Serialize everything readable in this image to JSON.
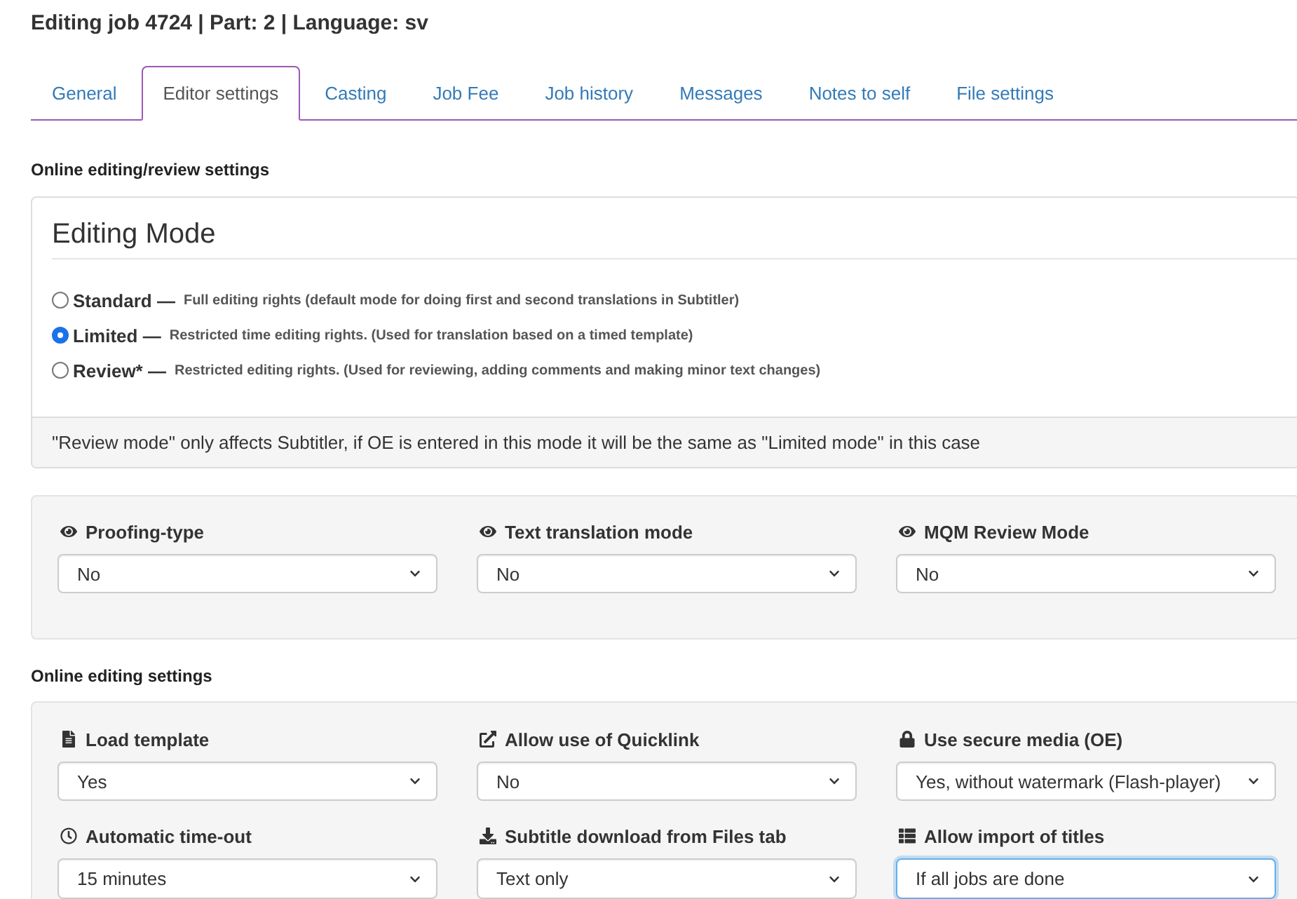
{
  "page": {
    "title": "Editing job 4724 | Part: 2 | Language: sv"
  },
  "tabs": [
    {
      "label": "General",
      "selected": false
    },
    {
      "label": "Editor settings",
      "selected": true
    },
    {
      "label": "Casting",
      "selected": false
    },
    {
      "label": "Job Fee",
      "selected": false
    },
    {
      "label": "Job history",
      "selected": false
    },
    {
      "label": "Messages",
      "selected": false
    },
    {
      "label": "Notes to self",
      "selected": false
    },
    {
      "label": "File settings",
      "selected": false
    }
  ],
  "review_section": {
    "heading": "Online editing/review settings",
    "editing_mode": {
      "title": "Editing Mode",
      "options": [
        {
          "label": "Standard —",
          "description": "Full editing rights (default mode for doing first and second translations in Subtitler)",
          "selected": false
        },
        {
          "label": "Limited —",
          "description": "Restricted time editing rights. (Used for translation based on a timed template)",
          "selected": true
        },
        {
          "label": "Review* —",
          "description": "Restricted editing rights. (Used for reviewing, adding comments and making minor text changes)",
          "selected": false
        }
      ],
      "note": "\"Review mode\" only affects Subtitler, if OE is entered in this mode it will be the same as \"Limited mode\" in this case"
    },
    "fields": [
      {
        "label": "Proofing-type",
        "value": "No",
        "focused": false
      },
      {
        "label": "Text translation mode",
        "value": "No",
        "focused": false
      },
      {
        "label": "MQM Review Mode",
        "value": "No",
        "focused": false
      }
    ]
  },
  "editing_section": {
    "heading": "Online editing settings",
    "fields": [
      {
        "label": "Load template",
        "value": "Yes",
        "focused": false
      },
      {
        "label": "Allow use of Quicklink",
        "value": "No",
        "focused": false
      },
      {
        "label": "Use secure media (OE)",
        "value": "Yes, without watermark (Flash-player)",
        "focused": false
      },
      {
        "label": "Automatic time-out",
        "value": "15 minutes",
        "focused": false
      },
      {
        "label": "Subtitle download from Files tab",
        "value": "Text only",
        "focused": false
      },
      {
        "label": "Allow import of titles",
        "value": "If all jobs are done",
        "focused": true
      }
    ]
  }
}
